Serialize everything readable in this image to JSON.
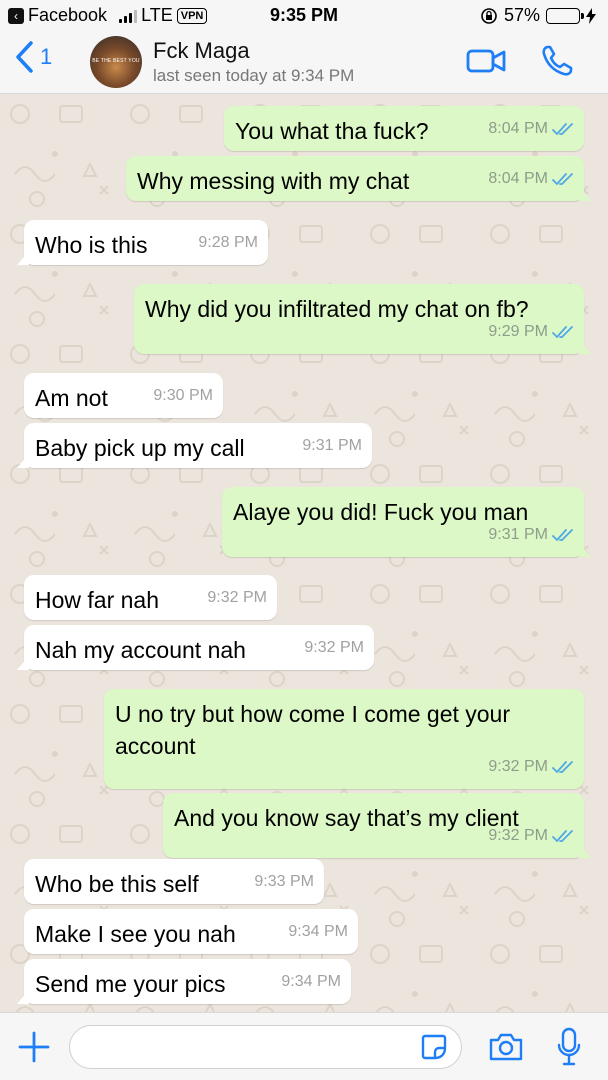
{
  "status_bar": {
    "back_app": "Facebook",
    "network": "LTE",
    "vpn": "VPN",
    "time": "9:35 PM",
    "battery": "57%",
    "battery_level": 0.57
  },
  "header": {
    "back_count": "1",
    "avatar_text": "BE THE BEST YOU",
    "contact_name": "Fck Maga",
    "last_seen": "last seen today at 9:34 PM"
  },
  "colors": {
    "accent": "#1e7ef5",
    "outgoing_bubble": "#dcf8c6",
    "incoming_bubble": "#ffffff",
    "read_ticks": "#4fa8e6",
    "wallpaper": "#ece5dd"
  },
  "messages": [
    {
      "dir": "out",
      "text": "You what tha fuck?",
      "time": "8:04 PM",
      "read": true
    },
    {
      "dir": "out",
      "text": "Why messing with my chat",
      "time": "8:04 PM",
      "read": true
    },
    {
      "dir": "in",
      "text": "Who is this",
      "time": "9:28 PM"
    },
    {
      "dir": "out",
      "text": "Why did you infiltrated my chat on fb?",
      "time": "9:29 PM",
      "read": true
    },
    {
      "dir": "in",
      "text": "Am not",
      "time": "9:30 PM"
    },
    {
      "dir": "in",
      "text": "Baby pick up my call",
      "time": "9:31 PM"
    },
    {
      "dir": "out",
      "text": "Alaye you did! Fuck you man",
      "time": "9:31 PM",
      "read": true
    },
    {
      "dir": "in",
      "text": "How far nah",
      "time": "9:32 PM"
    },
    {
      "dir": "in",
      "text": "Nah my account nah",
      "time": "9:32 PM"
    },
    {
      "dir": "out",
      "text": "U no try but how come I come get your account",
      "time": "9:32 PM",
      "read": true
    },
    {
      "dir": "out",
      "text": "And you know say that’s my client",
      "time": "9:32 PM",
      "read": true
    },
    {
      "dir": "in",
      "text": "Who be this self",
      "time": "9:33 PM"
    },
    {
      "dir": "in",
      "text": "Make I see you nah",
      "time": "9:34 PM"
    },
    {
      "dir": "in",
      "text": "Send me your pics",
      "time": "9:34 PM"
    }
  ],
  "input": {
    "value": "",
    "placeholder": ""
  },
  "icons": {
    "back": "chevron-left-icon",
    "video": "video-camera-icon",
    "call": "phone-icon",
    "plus": "plus-icon",
    "sticker": "sticker-icon",
    "camera": "camera-icon",
    "mic": "microphone-icon"
  }
}
